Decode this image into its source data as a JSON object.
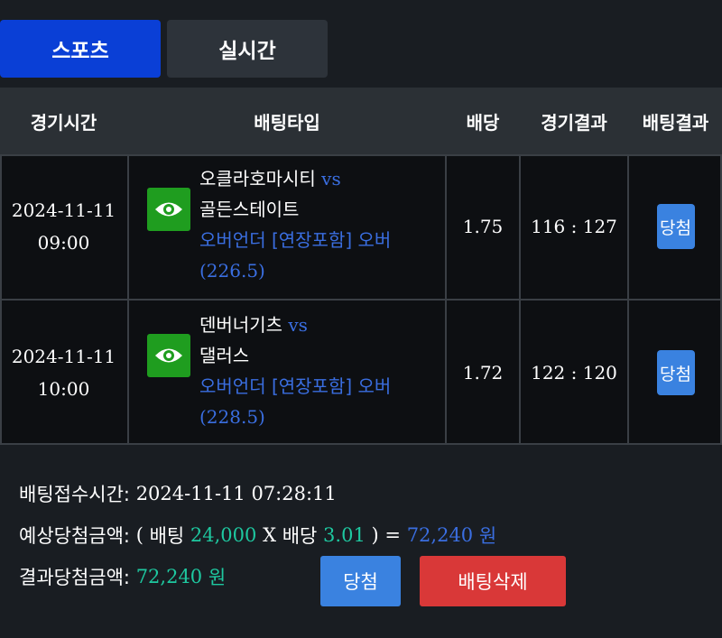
{
  "tabs": {
    "sports": "스포츠",
    "live": "실시간"
  },
  "table": {
    "headers": {
      "time": "경기시간",
      "bet_type": "배팅타입",
      "odds": "배당",
      "game_result": "경기결과",
      "bet_result": "배팅결과"
    },
    "rows": [
      {
        "date": "2024-11-11",
        "time": "09:00",
        "home": "오클라호마시티",
        "vs": "vs",
        "away": "골든스테이트",
        "bet_type": "오버언더 [연장포함] 오버",
        "line": "(226.5)",
        "odds": "1.75",
        "score": "116 : 127",
        "result": "당첨"
      },
      {
        "date": "2024-11-11",
        "time": "10:00",
        "home": "덴버너기츠",
        "vs": "vs",
        "away": "댈러스",
        "bet_type": "오버언더 [연장포함] 오버",
        "line": "(228.5)",
        "odds": "1.72",
        "score": "122 : 120",
        "result": "당첨"
      }
    ]
  },
  "summary": {
    "received_label": "배팅접수시간:",
    "received_value": "2024-11-11 07:28:11",
    "expected_label": "예상당첨금액:",
    "open_paren": "(",
    "bet_label": "배팅",
    "bet_amount": "24,000",
    "times": "X",
    "odds_label": "배당",
    "total_odds": "3.01",
    "close_paren": ")",
    "equals": "=",
    "expected_amount": "72,240",
    "currency": "원",
    "result_label": "결과당첨금액:",
    "result_amount": "72,240",
    "result_currency": "원"
  },
  "buttons": {
    "win": "당첨",
    "delete": "배팅삭제"
  },
  "colors": {
    "accent_blue": "#0a3fd6",
    "link_blue": "#3a6ee0",
    "green": "#1ec8a0",
    "danger": "#d93838",
    "eye_green": "#1f9d1f"
  }
}
